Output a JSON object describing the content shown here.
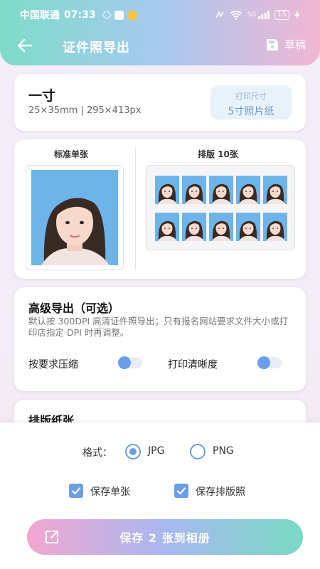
{
  "status_bar": {
    "carrier": "中国联通",
    "time": "07:33",
    "network": "5G",
    "battery": "15"
  },
  "header": {
    "title": "证件照导出",
    "draft_label": "草稿"
  },
  "spec": {
    "name": "一寸",
    "dimensions": "25×35mm | 295×413px",
    "print_size_label": "打印尺寸",
    "print_size_value": "5寸照片纸"
  },
  "preview": {
    "single_title": "标准单张",
    "sheet_title": "排版 10张",
    "sheet_photo_count": 10
  },
  "advanced": {
    "title": "高级导出（可选）",
    "description": "默认按 300DPI 高清证件照导出；只有报名网站要求文件大小或打印店指定 DPI 时再调整。",
    "options": [
      {
        "label": "按要求压缩",
        "enabled": false
      },
      {
        "label": "打印清晰度",
        "enabled": false
      }
    ]
  },
  "paper_section": {
    "title": "排版纸张"
  },
  "export": {
    "format_label": "格式：",
    "formats": [
      {
        "label": "JPG",
        "selected": true
      },
      {
        "label": "PNG",
        "selected": false
      }
    ],
    "checks": [
      {
        "label": "保存单张",
        "checked": true
      },
      {
        "label": "保存排版照",
        "checked": true
      }
    ],
    "save_button": "保存 2 张到相册"
  },
  "colors": {
    "accent": "#6b9ee8",
    "photo_background": "#6fb4e8"
  }
}
